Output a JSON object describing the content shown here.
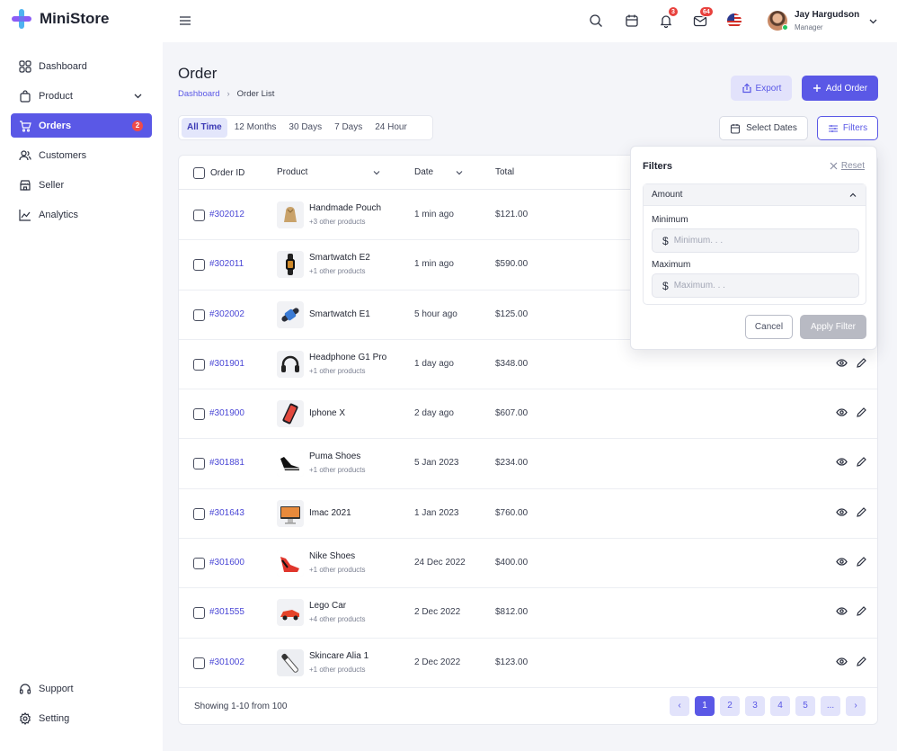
{
  "brand": {
    "name": "MiniStore",
    "accent": "#5a58e6"
  },
  "sidebar": {
    "items": [
      {
        "label": "Dashboard",
        "icon": "dashboard-icon"
      },
      {
        "label": "Product",
        "icon": "shopping-bag-icon"
      },
      {
        "label": "Orders",
        "icon": "cart-icon",
        "badge": "2",
        "active": true
      },
      {
        "label": "Customers",
        "icon": "users-icon"
      },
      {
        "label": "Seller",
        "icon": "store-icon"
      },
      {
        "label": "Analytics",
        "icon": "chart-line-icon"
      }
    ],
    "bottom": [
      {
        "label": "Support",
        "icon": "headset-icon"
      },
      {
        "label": "Setting",
        "icon": "gear-icon"
      }
    ]
  },
  "header": {
    "notifications_count": "3",
    "messages_count": "64",
    "user": {
      "name": "Jay Hargudson",
      "role": "Manager"
    }
  },
  "page": {
    "title": "Order",
    "breadcrumb": {
      "parent": "Dashboard",
      "current": "Order List"
    },
    "export_label": "Export",
    "add_label": "Add Order"
  },
  "time_filters": [
    "All Time",
    "12 Months",
    "30 Days",
    "7 Days",
    "24 Hour"
  ],
  "select_dates_label": "Select Dates",
  "filters_label": "Filters",
  "table": {
    "columns": {
      "order_id": "Order ID",
      "product": "Product",
      "date": "Date",
      "total": "Total"
    },
    "rows": [
      {
        "id": "#302012",
        "product": "Handmade Pouch",
        "sub": "+3 other products",
        "date": "1 min ago",
        "total": "$121.00"
      },
      {
        "id": "#302011",
        "product": "Smartwatch E2",
        "sub": "+1 other products",
        "date": "1 min ago",
        "total": "$590.00"
      },
      {
        "id": "#302002",
        "product": "Smartwatch E1",
        "sub": "",
        "date": "5 hour ago",
        "total": "$125.00"
      },
      {
        "id": "#301901",
        "product": "Headphone G1 Pro",
        "sub": "+1 other products",
        "date": "1 day ago",
        "total": "$348.00"
      },
      {
        "id": "#301900",
        "product": "Iphone X",
        "sub": "",
        "date": "2 day ago",
        "total": "$607.00"
      },
      {
        "id": "#301881",
        "product": "Puma Shoes",
        "sub": "+1 other products",
        "date": "5 Jan 2023",
        "total": "$234.00"
      },
      {
        "id": "#301643",
        "product": "Imac 2021",
        "sub": "",
        "date": "1 Jan 2023",
        "total": "$760.00"
      },
      {
        "id": "#301600",
        "product": "Nike Shoes",
        "sub": "+1 other products",
        "date": "24 Dec 2022",
        "total": "$400.00"
      },
      {
        "id": "#301555",
        "product": "Lego Car",
        "sub": "+4 other products",
        "date": "2 Dec 2022",
        "total": "$812.00"
      },
      {
        "id": "#301002",
        "product": "Skincare Alia 1",
        "sub": "+1 other products",
        "date": "2 Dec 2022",
        "total": "$123.00"
      }
    ],
    "showing": "Showing 1-10 from 100",
    "pages": [
      "1",
      "2",
      "3",
      "4",
      "5",
      "..."
    ]
  },
  "filter_panel": {
    "title": "Filters",
    "reset": "Reset",
    "group": "Amount",
    "min_label": "Minimum",
    "min_placeholder": "Minimum. . .",
    "max_label": "Maximum",
    "max_placeholder": "Maximum. . .",
    "cancel": "Cancel",
    "apply": "Apply Filter"
  }
}
